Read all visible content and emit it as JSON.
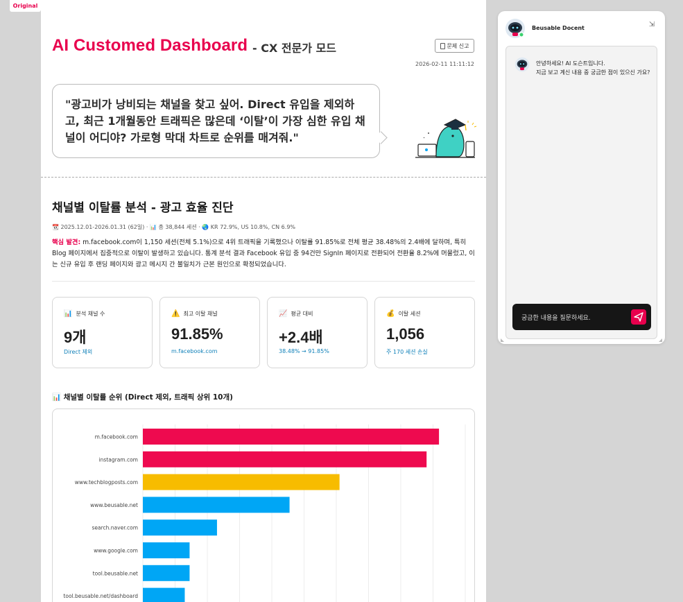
{
  "original_tab": "Original",
  "header": {
    "title": "AI Customed Dashboard",
    "subtitle": "- CX 전문가 모드",
    "report_button": "문제 신고",
    "timestamp": "2026-02-11 11:11:12"
  },
  "prompt": {
    "text": "\"광고비가 낭비되는 채널을 찾고 싶어. Direct 유입을 제외하고, 최근 1개월동안 트래픽은 많은데 ‘이탈’이 가장 심한 유입 채널이 어디야? 가로형 막대 차트로 순위를 매겨줘.\""
  },
  "analysis": {
    "title": "채널별 이탈률 분석 - 광고 효율 진단",
    "meta": "📆 2025.12.01-2026.01.31 (62일) · 📊 총 38,844 세션 · 🌏 KR 72.9%, US 10.8%, CN 6.9%",
    "finding_label": "핵심 발견:",
    "finding_text": " m.facebook.com이 1,150 세션(전체 5.1%)으로 4위 트래픽을 기록했으나 이탈률 91.85%로 전체 평균 38.48%의 2.4배에 달하며, 특히 Blog 페이지에서 집중적으로 이탈이 발생하고 있습니다. 통계 분석 결과 Facebook 유입 중 94건만 SignIn 페이지로 전환되어 전환율 8.2%에 머물렀고, 이는 신규 유입 후 랜딩 페이지와 광고 메시지 간 불일치가 근본 원인으로 확정되었습니다."
  },
  "kpis": [
    {
      "icon": "📊",
      "icon_name": "bar-chart-icon",
      "label": "분석 채널 수",
      "value": "9개",
      "sub": "Direct 제외"
    },
    {
      "icon": "⚠️",
      "icon_name": "warning-icon",
      "label": "최고 이탈 채널",
      "value": "91.85%",
      "sub": "m.facebook.com"
    },
    {
      "icon": "📈",
      "icon_name": "trend-up-icon",
      "label": "평균 대비",
      "value": "+2.4배",
      "sub": "38.48% → 91.85%"
    },
    {
      "icon": "💰",
      "icon_name": "money-bag-icon",
      "label": "이탈 세션",
      "value": "1,056",
      "sub": "주 170 세션 손실"
    }
  ],
  "chart_heading": "📊 채널별 이탈률 순위 (Direct 제외, 트래픽 상위 10개)",
  "chart_data": {
    "type": "bar",
    "orientation": "horizontal",
    "categories": [
      "m.facebook.com",
      "instagram.com",
      "www.techblogposts.com",
      "www.beusable.net",
      "search.naver.com",
      "www.google.com",
      "tool.beusable.net",
      "tool.beusable.net/dashboard"
    ],
    "values": [
      91.85,
      88.0,
      61.0,
      45.5,
      23.0,
      14.5,
      14.5,
      13.0
    ],
    "colors": [
      "#ee0a4f",
      "#ee0a4f",
      "#f7bc00",
      "#00a6f5",
      "#00a6f5",
      "#00a6f5",
      "#00a6f5",
      "#00a6f5"
    ],
    "xlim": [
      0,
      100
    ],
    "grid": true
  },
  "docent": {
    "name": "Beusable Docent",
    "greeting_line1": "안녕하세요! AI 도슨트입니다.",
    "greeting_line2": "지금 보고 계신 내용 중 궁금한 점이 있으신 가요?",
    "input_placeholder": "궁금한 내용을 질문하세요."
  }
}
